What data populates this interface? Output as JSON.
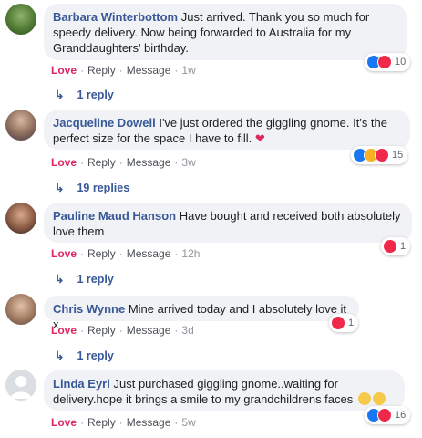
{
  "comments": [
    {
      "author": "Barbara Winterbottom",
      "text": "Just arrived. Thank you so much for speedy delivery. Now being forwarded to Australia for my Granddaughters' birthday.",
      "actions": {
        "love": "Love",
        "reply": "Reply",
        "message": "Message",
        "time": "1w"
      },
      "reactions": {
        "count": "10",
        "icons": [
          "like-icon",
          "love-icon"
        ]
      },
      "replies": "1 reply"
    },
    {
      "author": "Jacqueline Dowell",
      "text": "I've just ordered the giggling gnome. It's the perfect size for the space I have to fill.",
      "actions": {
        "love": "Love",
        "reply": "Reply",
        "message": "Message",
        "time": "3w"
      },
      "reactions": {
        "count": "15",
        "icons": [
          "like-icon",
          "haha-icon",
          "love-icon"
        ]
      },
      "replies": "19 replies"
    },
    {
      "author": "Pauline Maud Hanson",
      "text": "Have bought and received both absolutely love them",
      "actions": {
        "love": "Love",
        "reply": "Reply",
        "message": "Message",
        "time": "12h"
      },
      "reactions": {
        "count": "1",
        "icons": [
          "love-icon"
        ]
      },
      "replies": "1 reply"
    },
    {
      "author": "Chris Wynne",
      "text": "Mine arrived today and I absolutely love it x",
      "actions": {
        "love": "Love",
        "reply": "Reply",
        "message": "Message",
        "time": "3d"
      },
      "reactions": {
        "count": "1",
        "icons": [
          "love-icon"
        ]
      },
      "replies": "1 reply"
    },
    {
      "author": "Linda Eyrl",
      "text": "Just purchased giggling gnome..waiting for delivery.hope it brings a smile to my grandchildrens faces",
      "actions": {
        "love": "Love",
        "reply": "Reply",
        "message": "Message",
        "time": "5w"
      },
      "reactions": {
        "count": "16",
        "icons": [
          "like-icon",
          "love-icon"
        ]
      }
    }
  ],
  "colors": {
    "author": "#385898",
    "love": "#e0245e",
    "bubble": "#f0f2f5",
    "like": "#1877f2",
    "heart": "#f02849"
  }
}
